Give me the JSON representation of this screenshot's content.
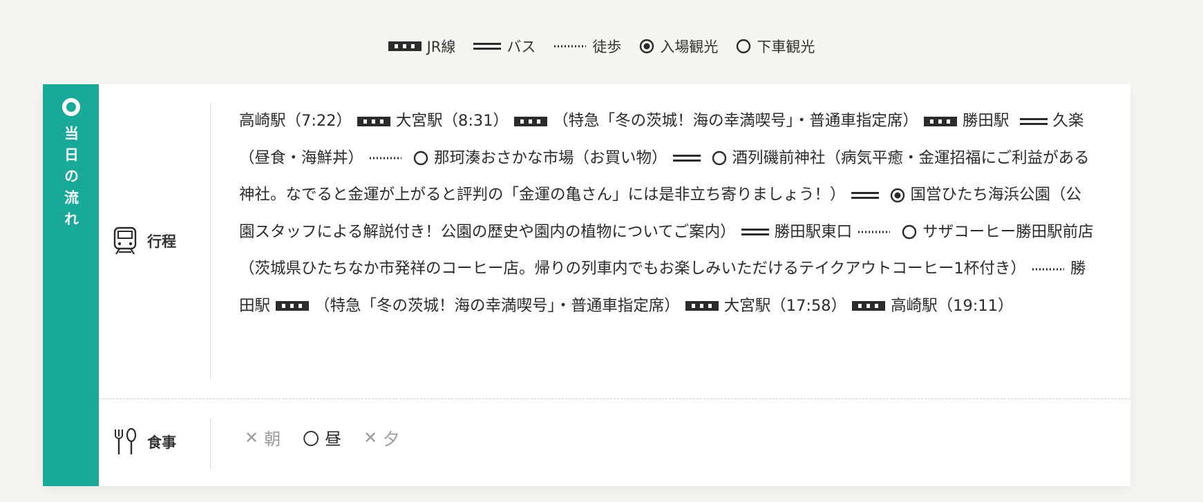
{
  "legend": {
    "jr": "JR線",
    "bus": "バス",
    "walk": "徒歩",
    "visit": "入場観光",
    "drop": "下車観光"
  },
  "side_tab": {
    "title": "当日の流れ"
  },
  "schedule": {
    "label": "行程",
    "segments": {
      "s1": "高崎駅（7:22）",
      "s2": "大宮駅（8:31）",
      "s3": "（特急「冬の茨城！海の幸満喫号」・普通車指定席）",
      "s4": "勝田駅",
      "s5": "久楽（昼食・海鮮丼）",
      "s6": "那珂湊おさかな市場（お買い物）",
      "s7": "酒列磯前神社（病気平癒・金運招福にご利益がある神社。なでると金運が上がると評判の「金運の亀さん」には是非立ち寄りましょう！）",
      "s8": "国営ひたち海浜公園（公園スタッフによる解説付き！公園の歴史や園内の植物についてご案内）",
      "s9": "勝田駅東口",
      "s10": "サザコーヒー勝田駅前店（茨城県ひたちなか市発祥のコーヒー店。帰りの列車内でもお楽しみいただけるテイクアウトコーヒー1杯付き）",
      "s11": "勝田駅",
      "s12": "（特急「冬の茨城！海の幸満喫号」・普通車指定席）",
      "s13": "大宮駅（17:58）",
      "s14": "高崎駅（19:11）"
    }
  },
  "meal": {
    "label": "食事",
    "breakfast": {
      "mark": "✕",
      "label": "朝",
      "included": false
    },
    "lunch": {
      "mark": "〇",
      "label": "昼",
      "included": true
    },
    "dinner": {
      "mark": "✕",
      "label": "夕",
      "included": false
    }
  },
  "colors": {
    "accent": "#18a999",
    "text": "#2b2b2b",
    "background": "#f5f5f2"
  }
}
